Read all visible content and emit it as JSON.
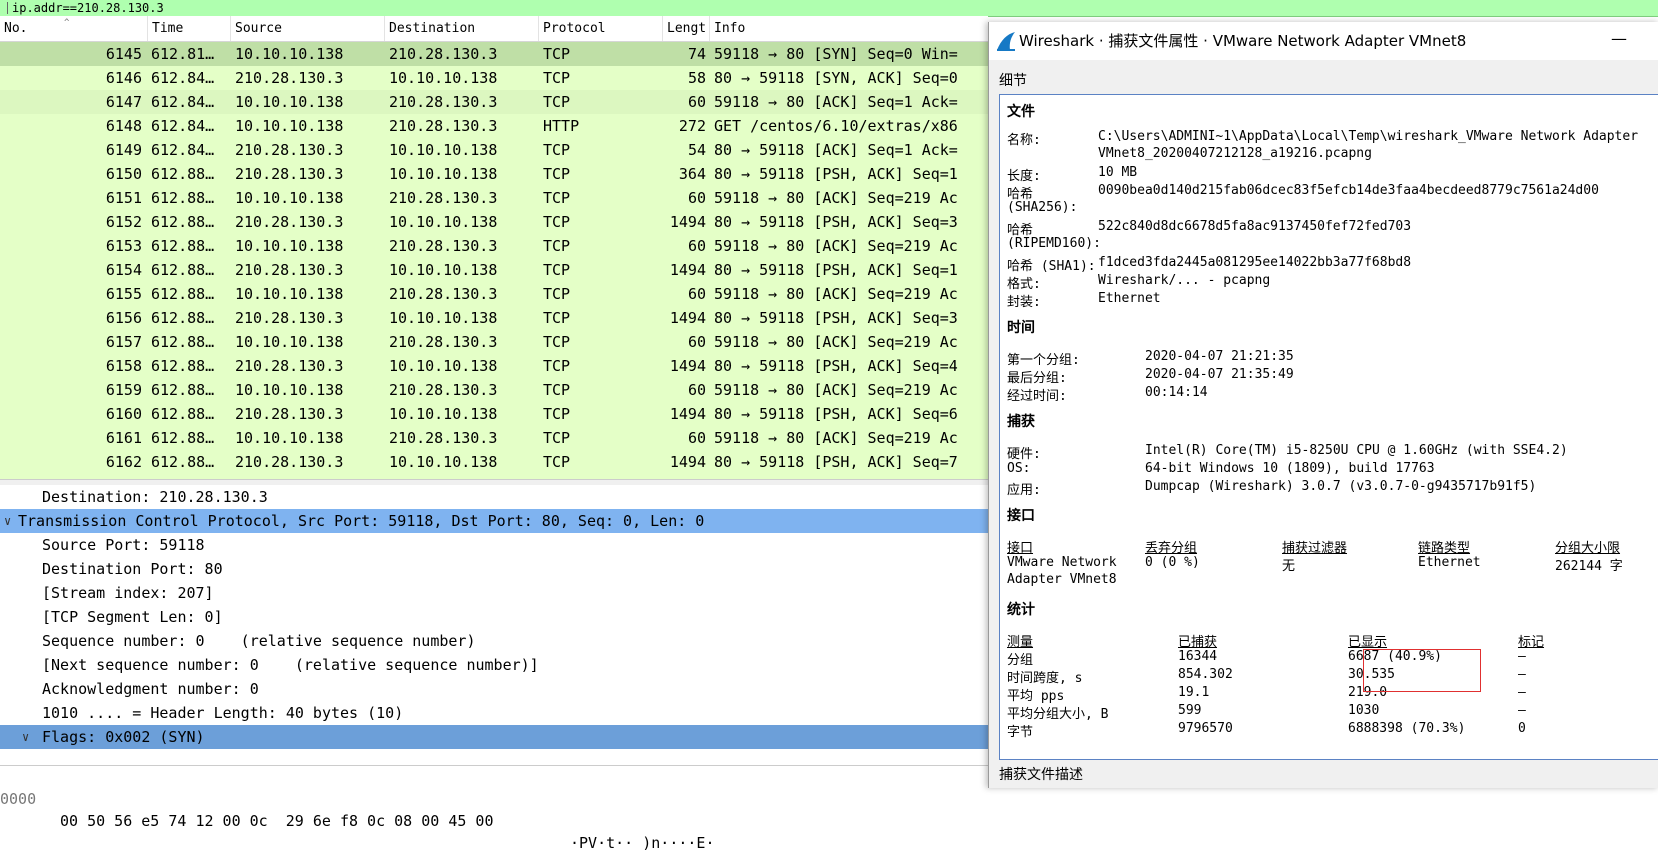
{
  "filter": {
    "value": "ip.addr==210.28.130.3"
  },
  "packet_list": {
    "columns": {
      "no": "No.",
      "time": "Time",
      "source": "Source",
      "destination": "Destination",
      "protocol": "Protocol",
      "length": "Lengt",
      "info": "Info"
    },
    "rows": [
      {
        "no": "6145",
        "time": "612.81…",
        "src": "10.10.10.138",
        "dst": "210.28.130.3",
        "proto": "TCP",
        "len": "74",
        "info": "59118 → 80 [SYN] Seq=0 Win="
      },
      {
        "no": "6146",
        "time": "612.84…",
        "src": "210.28.130.3",
        "dst": "10.10.10.138",
        "proto": "TCP",
        "len": "58",
        "info": "80 → 59118 [SYN, ACK] Seq=0"
      },
      {
        "no": "6147",
        "time": "612.84…",
        "src": "10.10.10.138",
        "dst": "210.28.130.3",
        "proto": "TCP",
        "len": "60",
        "info": "59118 → 80 [ACK] Seq=1 Ack="
      },
      {
        "no": "6148",
        "time": "612.84…",
        "src": "10.10.10.138",
        "dst": "210.28.130.3",
        "proto": "HTTP",
        "len": "272",
        "info": "GET /centos/6.10/extras/x86"
      },
      {
        "no": "6149",
        "time": "612.84…",
        "src": "210.28.130.3",
        "dst": "10.10.10.138",
        "proto": "TCP",
        "len": "54",
        "info": "80 → 59118 [ACK] Seq=1 Ack="
      },
      {
        "no": "6150",
        "time": "612.88…",
        "src": "210.28.130.3",
        "dst": "10.10.10.138",
        "proto": "TCP",
        "len": "364",
        "info": "80 → 59118 [PSH, ACK] Seq=1"
      },
      {
        "no": "6151",
        "time": "612.88…",
        "src": "10.10.10.138",
        "dst": "210.28.130.3",
        "proto": "TCP",
        "len": "60",
        "info": "59118 → 80 [ACK] Seq=219 Ac"
      },
      {
        "no": "6152",
        "time": "612.88…",
        "src": "210.28.130.3",
        "dst": "10.10.10.138",
        "proto": "TCP",
        "len": "1494",
        "info": "80 → 59118 [PSH, ACK] Seq=3"
      },
      {
        "no": "6153",
        "time": "612.88…",
        "src": "10.10.10.138",
        "dst": "210.28.130.3",
        "proto": "TCP",
        "len": "60",
        "info": "59118 → 80 [ACK] Seq=219 Ac"
      },
      {
        "no": "6154",
        "time": "612.88…",
        "src": "210.28.130.3",
        "dst": "10.10.10.138",
        "proto": "TCP",
        "len": "1494",
        "info": "80 → 59118 [PSH, ACK] Seq=1"
      },
      {
        "no": "6155",
        "time": "612.88…",
        "src": "10.10.10.138",
        "dst": "210.28.130.3",
        "proto": "TCP",
        "len": "60",
        "info": "59118 → 80 [ACK] Seq=219 Ac"
      },
      {
        "no": "6156",
        "time": "612.88…",
        "src": "210.28.130.3",
        "dst": "10.10.10.138",
        "proto": "TCP",
        "len": "1494",
        "info": "80 → 59118 [PSH, ACK] Seq=3"
      },
      {
        "no": "6157",
        "time": "612.88…",
        "src": "10.10.10.138",
        "dst": "210.28.130.3",
        "proto": "TCP",
        "len": "60",
        "info": "59118 → 80 [ACK] Seq=219 Ac"
      },
      {
        "no": "6158",
        "time": "612.88…",
        "src": "210.28.130.3",
        "dst": "10.10.10.138",
        "proto": "TCP",
        "len": "1494",
        "info": "80 → 59118 [PSH, ACK] Seq=4"
      },
      {
        "no": "6159",
        "time": "612.88…",
        "src": "10.10.10.138",
        "dst": "210.28.130.3",
        "proto": "TCP",
        "len": "60",
        "info": "59118 → 80 [ACK] Seq=219 Ac"
      },
      {
        "no": "6160",
        "time": "612.88…",
        "src": "210.28.130.3",
        "dst": "10.10.10.138",
        "proto": "TCP",
        "len": "1494",
        "info": "80 → 59118 [PSH, ACK] Seq=6"
      },
      {
        "no": "6161",
        "time": "612.88…",
        "src": "10.10.10.138",
        "dst": "210.28.130.3",
        "proto": "TCP",
        "len": "60",
        "info": "59118 → 80 [ACK] Seq=219 Ac"
      },
      {
        "no": "6162",
        "time": "612.88…",
        "src": "210.28.130.3",
        "dst": "10.10.10.138",
        "proto": "TCP",
        "len": "1494",
        "info": "80 → 59118 [PSH, ACK] Seq=7"
      }
    ]
  },
  "detail": {
    "destination": "Destination: 210.28.130.3",
    "tcp": "Transmission Control Protocol, Src Port: 59118, Dst Port: 80, Seq: 0, Len: 0",
    "src_port": "Source Port: 59118",
    "dst_port": "Destination Port: 80",
    "stream_index": "[Stream index: 207]",
    "segment_len": "[TCP Segment Len: 0]",
    "seq": "Sequence number: 0    (relative sequence number)",
    "next_seq": "[Next sequence number: 0    (relative sequence number)]",
    "ack": "Acknowledgment number: 0",
    "header_len": "1010 .... = Header Length: 40 bytes (10)",
    "flags": "Flags: 0x002 (SYN)"
  },
  "bytes": {
    "offset": "0000",
    "hex": "00 50 56 e5 74 12 00 0c  29 6e f8 0c 08 00 45 00",
    "ascii": "·PV·t·· )n····E·"
  },
  "dialog": {
    "title": "Wireshark · 捕获文件属性 · VMware Network Adapter VMnet8",
    "minimize": "—",
    "details_label": "细节",
    "file": {
      "heading": "文件",
      "name_label": "名称:",
      "name_line1": "C:\\Users\\ADMINI~1\\AppData\\Local\\Temp\\wireshark_VMware Network Adapter",
      "name_line2": "VMnet8_20200407212128_a19216.pcapng",
      "length_label": "长度:",
      "length": "10 MB",
      "sha256_label1": "哈希",
      "sha256_label2": "(SHA256):",
      "sha256": "0090bea0d140d215fab06dcec83f5efcb14de3faa4becdeed8779c7561a24d00",
      "ripemd_label1": "哈希",
      "ripemd_label2": "(RIPEMD160):",
      "ripemd": "522c840d8dc6678d5fa8ac9137450fef72fed703",
      "sha1_label": "哈希 (SHA1):",
      "sha1": "f1dced3fda2445a081295ee14022bb3a77f68bd8",
      "format_label": "格式:",
      "format": "Wireshark/... - pcapng",
      "encap_label": "封装:",
      "encap": "Ethernet"
    },
    "time": {
      "heading": "时间",
      "first_label": "第一个分组:",
      "first": "2020-04-07 21:21:35",
      "last_label": "最后分组:",
      "last": "2020-04-07 21:35:49",
      "elapsed_label": "经过时间:",
      "elapsed": "00:14:14"
    },
    "capture": {
      "heading": "捕获",
      "hw_label": "硬件:",
      "hw": "Intel(R) Core(TM) i5-8250U CPU @ 1.60GHz (with SSE4.2)",
      "os_label": "OS:",
      "os": "64-bit Windows 10 (1809), build 17763",
      "app_label": "应用:",
      "app": "Dumpcap (Wireshark) 3.0.7 (v3.0.7-0-g9435717b91f5)"
    },
    "interfaces": {
      "heading": "接口",
      "headers": [
        "接口",
        "丢弃分组",
        "捕获过滤器",
        "链路类型",
        "分组大小限"
      ],
      "row": {
        "iface1": "VMware Network",
        "iface2": "Adapter VMnet8",
        "dropped": "0 (0 %)",
        "filter": "无",
        "link": "Ethernet",
        "snaplen": "262144 字"
      }
    },
    "stats": {
      "heading": "统计",
      "headers": [
        "测量",
        "已捕获",
        "已显示",
        "标记"
      ],
      "rows": [
        {
          "m": "分组",
          "cap": "16344",
          "shown": "6687 (40.9%)",
          "mark": "—"
        },
        {
          "m": "时间跨度, s",
          "cap": "854.302",
          "shown": "30.535",
          "mark": "—"
        },
        {
          "m": "平均 pps",
          "cap": "19.1",
          "shown": "219.0",
          "mark": "—"
        },
        {
          "m": "平均分组大小, B",
          "cap": "599",
          "shown": "1030",
          "mark": "—"
        },
        {
          "m": "字节",
          "cap": "9796570",
          "shown": "6888398 (70.3%)",
          "mark": "0"
        }
      ]
    },
    "desc_label": "捕获文件描述"
  }
}
